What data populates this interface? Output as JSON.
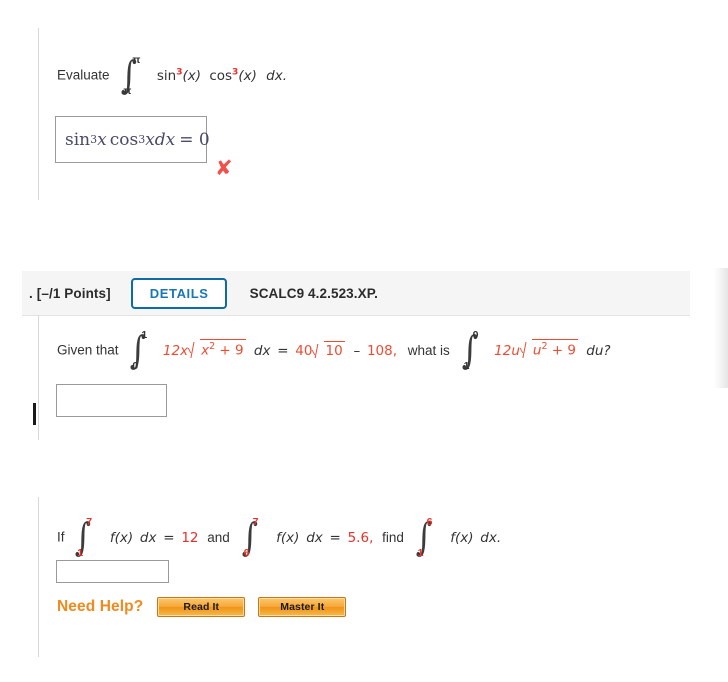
{
  "problem1": {
    "prompt_prefix": "Evaluate",
    "integral": {
      "upper_limit": "π",
      "lower_limit": "π",
      "integrand_sin": "sin",
      "sin_power": "3",
      "sin_arg": "(x)",
      "integrand_cos": "cos",
      "cos_power": "3",
      "cos_arg": "(x)",
      "differential": "dx."
    },
    "answer_value": {
      "sin": "sin",
      "sin_power": "3",
      "var1": "x",
      "cos": "cos",
      "cos_power": "3",
      "var2": "xdx",
      "equals": "= 0"
    },
    "grade_mark": "✘",
    "grade_status": "incorrect"
  },
  "question_header": {
    "index_marker": ".",
    "points": "[–/1 Points]",
    "details_label": "DETAILS",
    "question_code": "SCALC9 4.2.523.XP."
  },
  "problem2": {
    "prefix": "Given that",
    "integral_a": {
      "upper_limit": "1",
      "lower_limit": "0",
      "coefficient": "12x",
      "radicand_base": "x",
      "radicand_power": "2",
      "radicand_rest": " + 9",
      "differential": "dx"
    },
    "equals": "=",
    "result_coefficient": "40",
    "result_radicand": "10",
    "result_minus": "–",
    "result_constant": "108,",
    "middle_text": "what is",
    "integral_b": {
      "upper_limit": "0",
      "lower_limit": "1",
      "coefficient": "12u",
      "radicand_base": "u",
      "radicand_power": "2",
      "radicand_rest": " + 9",
      "differential": "du?"
    },
    "answer_value": ""
  },
  "problem3": {
    "prefix": "If",
    "integral_a": {
      "upper_limit": "7",
      "lower_limit": "1",
      "function": "f(x)",
      "differential": "dx"
    },
    "equals_a": "=",
    "value_a": "12",
    "conjunction": "and",
    "integral_b": {
      "upper_limit": "7",
      "lower_limit": "6",
      "function": "f(x)",
      "differential": "dx"
    },
    "equals_b": "=",
    "value_b": "5.6,",
    "find_text": "find",
    "integral_c": {
      "upper_limit": "6",
      "lower_limit": "1",
      "function": "f(x)",
      "differential": "dx."
    },
    "answer_value": "",
    "need_help": {
      "label": "Need Help?",
      "read_it_label": "Read It",
      "master_it_label": "Master It"
    }
  },
  "colors": {
    "red_math": "#e8302a",
    "orange_accent": "#f08a1c",
    "details_blue": "#1878b4",
    "wrong_mark": "#f2514b",
    "header_band": "#f5f5f5"
  }
}
